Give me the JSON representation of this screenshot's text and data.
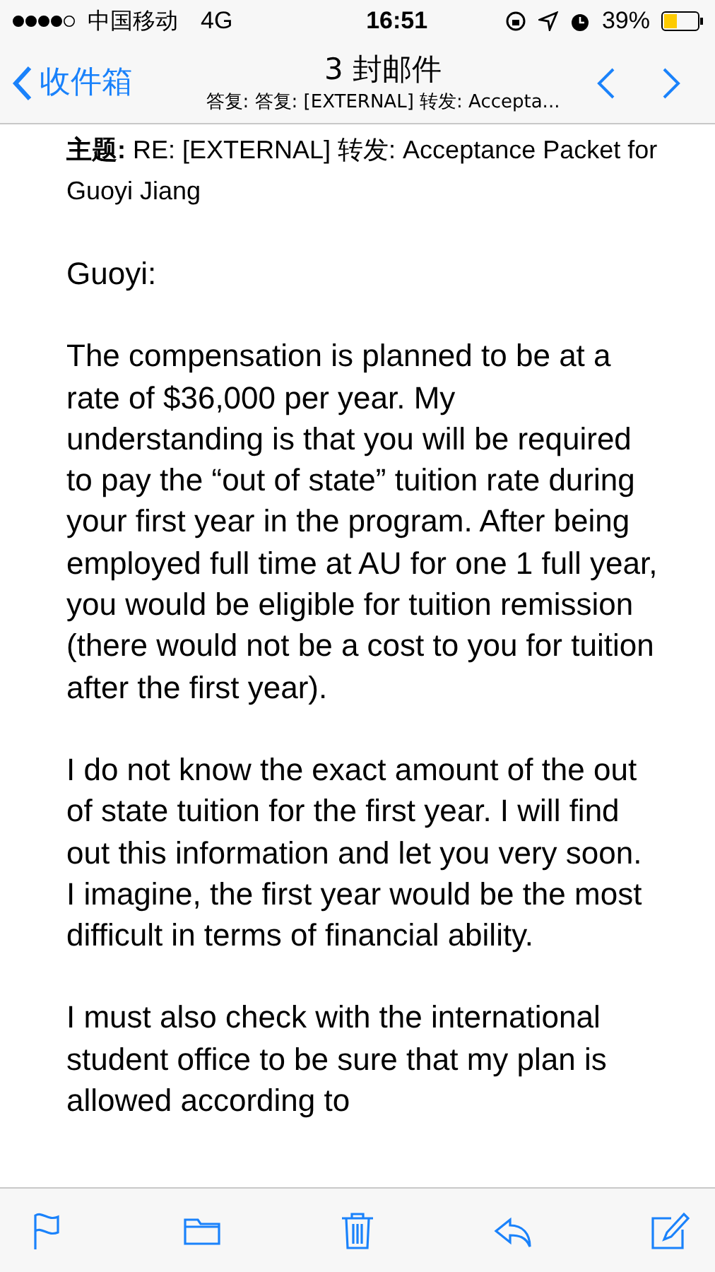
{
  "status_bar": {
    "carrier": "中国移动",
    "network": "4G",
    "time": "16:51",
    "battery": "39%"
  },
  "nav": {
    "back": "收件箱",
    "title": "3 封邮件",
    "subtitle": "答复: 答复: [EXTERNAL] 转发: Accepta..."
  },
  "message": {
    "subject_label": "主题:",
    "subject": "RE: [EXTERNAL] 转发: Acceptance Packet for Guoyi Jiang",
    "paragraphs": [
      "Guoyi:",
      "The compensation is planned to be at a rate of $36,000 per year.  My understanding is that you will be required to pay the “out of state” tuition rate during your first year in the program.  After being employed full time at AU for one 1 full year, you would be eligible for tuition remission (there would not be a cost to you for tuition after the first year).",
      "I do not know the exact amount of the out of state tuition for the first year.  I will find out this information and let you very soon.  I imagine, the first year would be the most difficult in terms of financial ability.",
      "I must also check with the international student office to be sure that my plan is allowed according to"
    ]
  },
  "toolbar": [
    {
      "kind": "flag"
    },
    {
      "kind": "folder"
    },
    {
      "kind": "trash"
    },
    {
      "kind": "reply"
    },
    {
      "kind": "compose"
    }
  ]
}
